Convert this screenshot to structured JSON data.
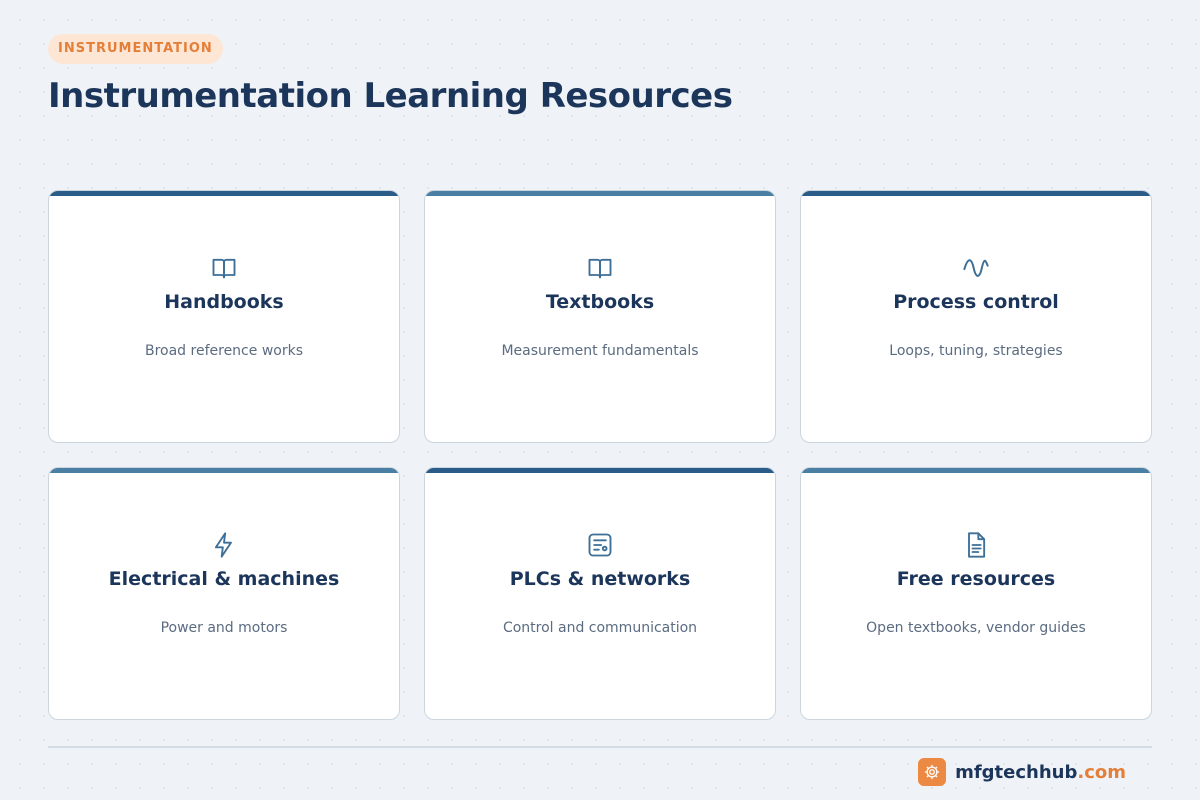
{
  "header": {
    "tag": "INSTRUMENTATION",
    "title": "Instrumentation Learning Resources"
  },
  "cards": [
    {
      "icon": "book-icon",
      "title": "Handbooks",
      "subtitle": "Broad reference works"
    },
    {
      "icon": "book-icon",
      "title": "Textbooks",
      "subtitle": "Measurement fundamentals"
    },
    {
      "icon": "sine-wave-icon",
      "title": "Process control",
      "subtitle": "Loops, tuning, strategies"
    },
    {
      "icon": "lightning-icon",
      "title": "Electrical & machines",
      "subtitle": "Power and motors"
    },
    {
      "icon": "plc-module-icon",
      "title": "PLCs & networks",
      "subtitle": "Control and communication"
    },
    {
      "icon": "document-icon",
      "title": "Free resources",
      "subtitle": "Open textbooks, vendor guides"
    }
  ],
  "footer": {
    "brand_name": "mfgtechhub",
    "brand_tld": ".com",
    "logo_icon": "gear-icon"
  },
  "colors": {
    "accent_orange": "#e47f3a",
    "navy": "#1c355a",
    "bar_dark": "#2b5b87",
    "bar_light": "#4b7ea3"
  }
}
